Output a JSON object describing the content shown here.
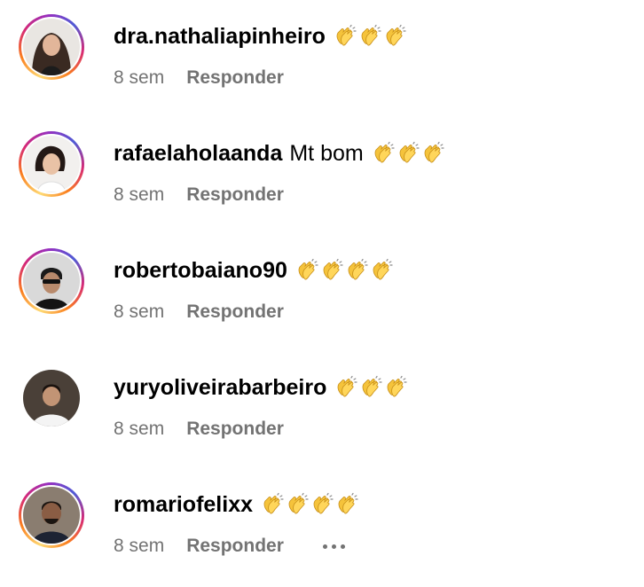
{
  "comments": [
    {
      "username": "dra.nathaliapinheiro",
      "text": "",
      "claps": 3,
      "time": "8 sem",
      "reply_label": "Responder",
      "has_story": true
    },
    {
      "username": "rafaelaholaanda",
      "text": "Mt bom",
      "claps": 3,
      "time": "8 sem",
      "reply_label": "Responder",
      "has_story": true
    },
    {
      "username": "robertobaiano90",
      "text": "",
      "claps": 4,
      "time": "8 sem",
      "reply_label": "Responder",
      "has_story": true
    },
    {
      "username": "yuryoliveirabarbeiro",
      "text": "",
      "claps": 3,
      "time": "8 sem",
      "reply_label": "Responder",
      "has_story": false
    },
    {
      "username": "romariofelixx",
      "text": "",
      "claps": 4,
      "time": "8 sem",
      "reply_label": "Responder",
      "has_story": true,
      "show_more": true
    }
  ],
  "icons": {
    "clap": "clapping-hands-emoji",
    "more": "more-options-icon"
  },
  "colors": {
    "meta_text": "#737373",
    "story_ring_start": "#feda75",
    "story_ring_mid": "#d62976",
    "story_ring_end": "#962fbf"
  }
}
